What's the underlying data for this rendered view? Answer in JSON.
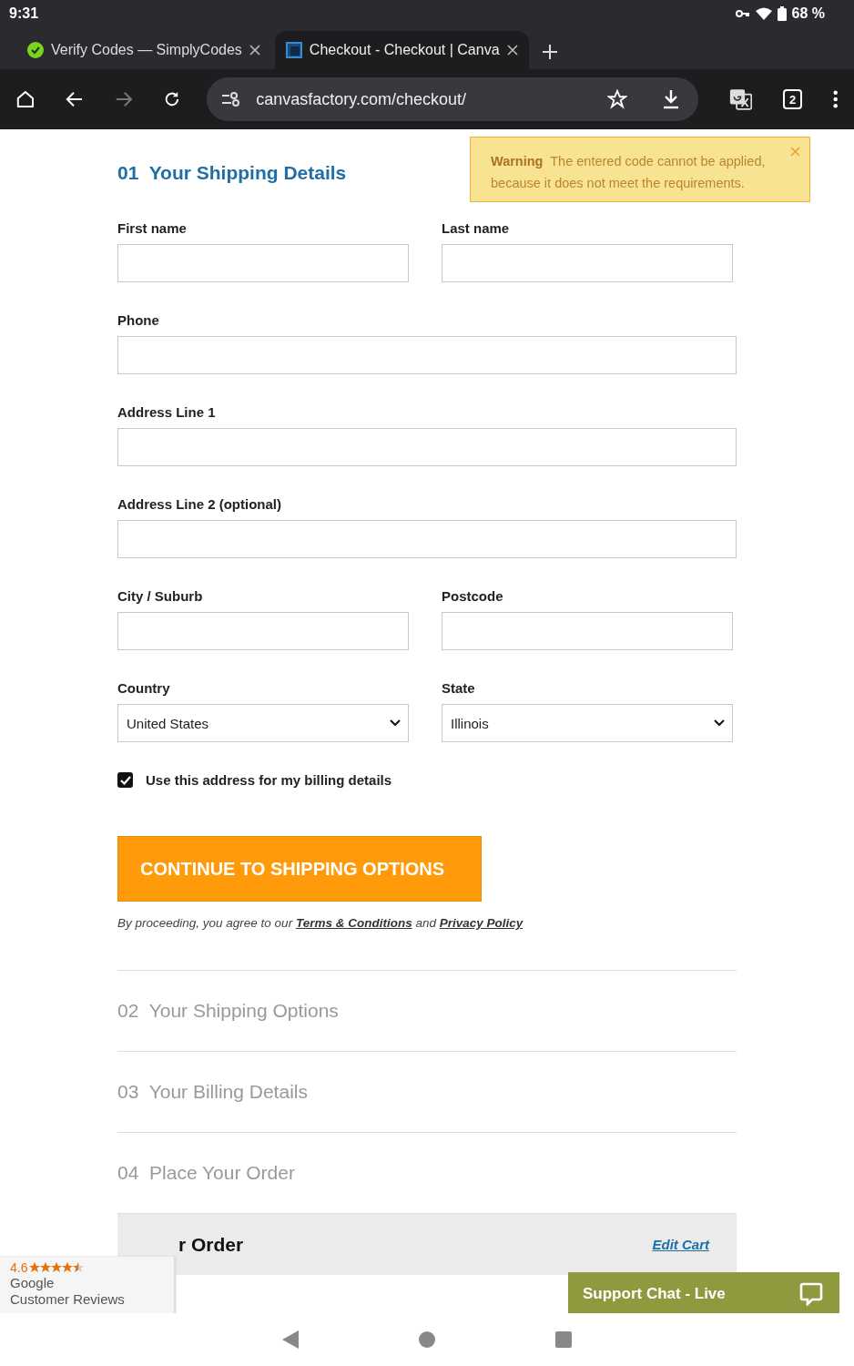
{
  "status_bar": {
    "time": "9:31",
    "battery": "68 %"
  },
  "tabs": [
    {
      "title": "Verify Codes — SimplyCodes",
      "selected": false,
      "kind": "simplycodes"
    },
    {
      "title": "Checkout - Checkout | Canva",
      "selected": true,
      "kind": "canvas"
    }
  ],
  "address_bar": {
    "url": "canvasfactory.com/checkout/"
  },
  "tab_count": "2",
  "warning": {
    "label": "Warning",
    "message": "The entered code cannot be applied, because it does not meet the requirements."
  },
  "section": {
    "number": "01",
    "title": "Your Shipping Details"
  },
  "field_rows": [
    [
      {
        "label": "First name",
        "kind": "text"
      },
      {
        "label": "Last name",
        "kind": "text"
      }
    ],
    [
      {
        "label": "Phone",
        "kind": "text"
      }
    ],
    [
      {
        "label": "Address Line 1",
        "kind": "text"
      }
    ],
    [
      {
        "label": "Address Line 2 (optional)",
        "kind": "text"
      }
    ],
    [
      {
        "label": "City / Suburb",
        "kind": "text"
      },
      {
        "label": "Postcode",
        "kind": "text"
      }
    ],
    [
      {
        "label": "Country",
        "kind": "select",
        "value": "United States"
      },
      {
        "label": "State",
        "kind": "select",
        "value": "Illinois"
      }
    ]
  ],
  "billing_checkbox": {
    "label": "Use this address for my billing details",
    "checked": true
  },
  "continue_button": "CONTINUE TO SHIPPING OPTIONS",
  "agreement": {
    "prefix": "By proceeding, you agree to our",
    "terms": "Terms & Conditions",
    "middle": "and",
    "privacy": "Privacy Policy"
  },
  "steps": [
    {
      "number": "02",
      "title": "Your Shipping Options"
    },
    {
      "number": "03",
      "title": "Your Billing Details"
    },
    {
      "number": "04",
      "title": "Place Your Order"
    }
  ],
  "order": {
    "title": "r Order",
    "edit": "Edit Cart"
  },
  "reviews_badge": {
    "rating": "4.6",
    "stars": 4.5,
    "source": "Google",
    "label": "Customer Reviews"
  },
  "support_chat": "Support Chat - Live"
}
